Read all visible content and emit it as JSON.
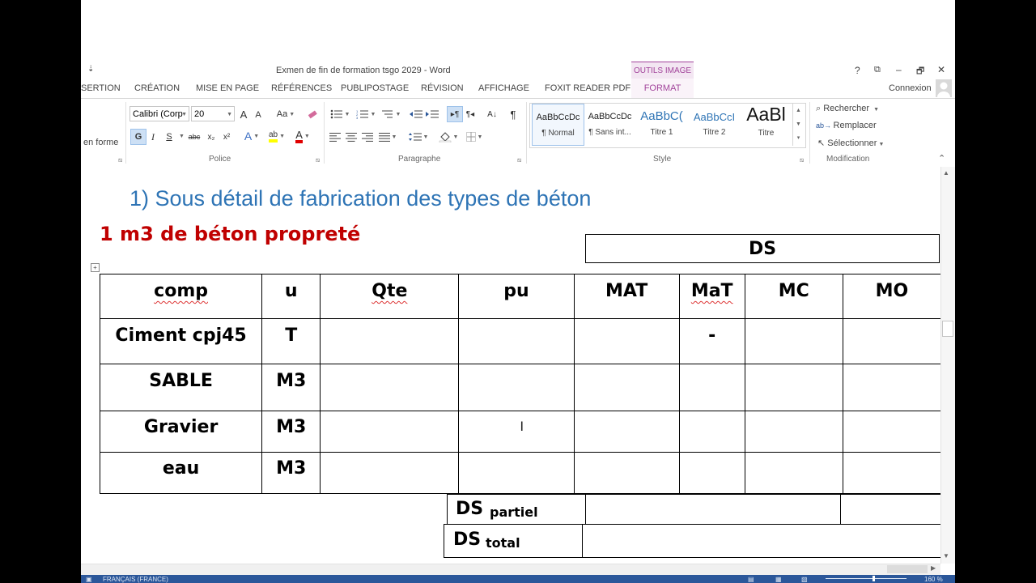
{
  "window": {
    "title": "Exmen de fin de formation tsgo 2029 - Word",
    "quick_access_glyph": "⇣",
    "help": "?",
    "restore": "⧉",
    "minimize": "–",
    "maximize": "🗗",
    "close": "✕",
    "context_tab_group": "OUTILS IMAGE"
  },
  "ribbon": {
    "tabs": [
      "SERTION",
      "CRÉATION",
      "MISE EN PAGE",
      "RÉFÉRENCES",
      "PUBLIPOSTAGE",
      "RÉVISION",
      "AFFICHAGE",
      "FOXIT READER PDF",
      "FORMAT"
    ],
    "account": "Connexion",
    "clipboard": {
      "partial_label": "en forme"
    },
    "font": {
      "name": "Calibri (Corp",
      "size": "20",
      "group_label": "Police",
      "grow": "A",
      "shrink": "A",
      "case": "Aa",
      "bold": "G",
      "italic": "I",
      "underline": "S",
      "strike": "abc",
      "sub": "x₂",
      "sup": "x²",
      "effects": "A",
      "highlight": "ab",
      "color": "A"
    },
    "paragraph": {
      "group_label": "Paragraphe",
      "pilcrow": "¶",
      "sort": "A↓"
    },
    "styles": {
      "group_label": "Style",
      "items": [
        {
          "preview": "AaBbCcDc",
          "name": "¶ Normal"
        },
        {
          "preview": "AaBbCcDc",
          "name": "¶ Sans int..."
        },
        {
          "preview": "AaBbC(",
          "name": "Titre 1"
        },
        {
          "preview": "AaBbCcI",
          "name": "Titre 2"
        },
        {
          "preview": "AaBl",
          "name": "Titre"
        }
      ]
    },
    "editing": {
      "group_label": "Modification",
      "find": "Rechercher",
      "replace": "Remplacer",
      "select": "Sélectionner"
    }
  },
  "document": {
    "heading": "1) Sous détail de fabrication des types de béton",
    "subheading": "1 m3 de béton propreté",
    "ds_header": "DS",
    "table": {
      "headers": [
        "comp",
        "u",
        "Qte",
        "pu",
        "MAT",
        "MaT",
        "MC",
        "MO"
      ],
      "rows": [
        [
          "Ciment cpj45",
          "T",
          "",
          "",
          "",
          "-",
          "",
          ""
        ],
        [
          "SABLE",
          "M3",
          "",
          "",
          "",
          "",
          "",
          ""
        ],
        [
          "Gravier",
          "M3",
          "",
          "",
          "",
          "",
          "",
          ""
        ],
        [
          "eau",
          "M3",
          "",
          "",
          "",
          "",
          "",
          ""
        ]
      ]
    },
    "ds_partiel": {
      "main": "DS",
      "sub": "partiel"
    },
    "ds_total": {
      "main": "DS",
      "sub": "total"
    }
  },
  "statusbar": {
    "language": "FRANÇAIS (FRANCE)",
    "zoom": "160 %"
  },
  "colors": {
    "accent": "#2b579a",
    "context_tab": "#a2449b",
    "heading": "#2e74b5",
    "subheading": "#c00000"
  }
}
